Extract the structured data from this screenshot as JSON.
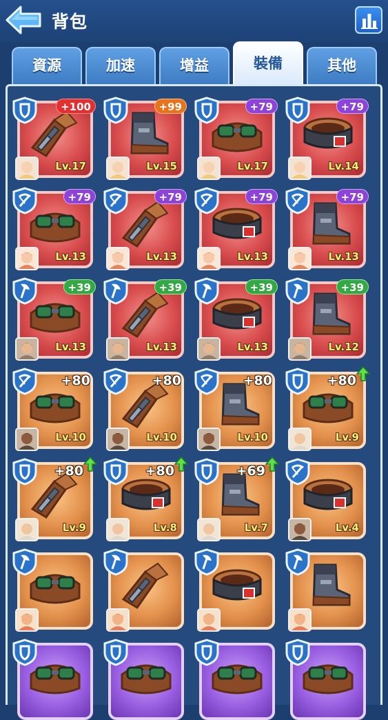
{
  "header": {
    "title": "背包"
  },
  "tabs": [
    {
      "label": "資源",
      "active": false
    },
    {
      "label": "加速",
      "active": false
    },
    {
      "label": "增益",
      "active": false
    },
    {
      "label": "裝備",
      "active": true
    },
    {
      "label": "其他",
      "active": false
    }
  ],
  "items": [
    {
      "rarity": "red",
      "class_icon": "shield",
      "badge": "+100",
      "badge_color": "red",
      "hero": "blonde-woman",
      "level": "Lv.17",
      "art": "gauntlet"
    },
    {
      "rarity": "red",
      "class_icon": "shield",
      "badge": "+99",
      "badge_color": "orange",
      "hero": "blonde-woman",
      "level": "Lv.15",
      "art": "boot"
    },
    {
      "rarity": "red",
      "class_icon": "shield",
      "badge": "+79",
      "badge_color": "purple",
      "hero": "blonde-woman",
      "level": "Lv.17",
      "art": "goggles"
    },
    {
      "rarity": "red",
      "class_icon": "shield",
      "badge": "+79",
      "badge_color": "purple",
      "hero": "blonde-woman",
      "level": "Lv.14",
      "art": "belt"
    },
    {
      "rarity": "red",
      "class_icon": "crossbow",
      "badge": "+79",
      "badge_color": "purple",
      "hero": "redhead-girl",
      "level": "Lv.13",
      "art": "goggles"
    },
    {
      "rarity": "red",
      "class_icon": "crossbow",
      "badge": "+79",
      "badge_color": "purple",
      "hero": "redhead-girl",
      "level": "Lv.13",
      "art": "gauntlet"
    },
    {
      "rarity": "red",
      "class_icon": "crossbow",
      "badge": "+79",
      "badge_color": "purple",
      "hero": "redhead-girl",
      "level": "Lv.13",
      "art": "belt"
    },
    {
      "rarity": "red",
      "class_icon": "crossbow",
      "badge": "+79",
      "badge_color": "purple",
      "hero": "redhead-girl",
      "level": "Lv.13",
      "art": "boot"
    },
    {
      "rarity": "red",
      "class_icon": "axe",
      "badge": "+39",
      "badge_color": "green",
      "hero": "bearded-dwarf",
      "level": "Lv.13",
      "art": "goggles"
    },
    {
      "rarity": "red",
      "class_icon": "axe",
      "badge": "+39",
      "badge_color": "green",
      "hero": "bearded-dwarf",
      "level": "Lv.13",
      "art": "gauntlet"
    },
    {
      "rarity": "red",
      "class_icon": "axe",
      "badge": "+39",
      "badge_color": "green",
      "hero": "bearded-dwarf",
      "level": "Lv.13",
      "art": "belt"
    },
    {
      "rarity": "red",
      "class_icon": "axe",
      "badge": "+39",
      "badge_color": "green",
      "hero": "bearded-dwarf",
      "level": "Lv.12",
      "art": "boot"
    },
    {
      "rarity": "orange",
      "class_icon": "crossbow",
      "badge": "+80",
      "badge_color": "plain",
      "arrow": false,
      "hero": "bald-man",
      "level": "Lv.10",
      "art": "goggles"
    },
    {
      "rarity": "orange",
      "class_icon": "crossbow",
      "badge": "+80",
      "badge_color": "plain",
      "arrow": false,
      "hero": "bald-man",
      "level": "Lv.10",
      "art": "gauntlet"
    },
    {
      "rarity": "orange",
      "class_icon": "crossbow",
      "badge": "+80",
      "badge_color": "plain",
      "arrow": false,
      "hero": "bald-man",
      "level": "Lv.10",
      "art": "boot"
    },
    {
      "rarity": "orange",
      "class_icon": "shield",
      "badge": "+80",
      "badge_color": "plain",
      "arrow": true,
      "hero": "old-dwarf",
      "level": "Lv.9",
      "art": "goggles"
    },
    {
      "rarity": "orange",
      "class_icon": "shield",
      "badge": "+80",
      "badge_color": "plain",
      "arrow": true,
      "hero": "old-dwarf",
      "level": "Lv.9",
      "art": "gauntlet"
    },
    {
      "rarity": "orange",
      "class_icon": "shield",
      "badge": "+80",
      "badge_color": "plain",
      "arrow": true,
      "hero": "old-dwarf",
      "level": "Lv.8",
      "art": "belt"
    },
    {
      "rarity": "orange",
      "class_icon": "shield",
      "badge": "+69",
      "badge_color": "plain",
      "arrow": true,
      "hero": "old-dwarf",
      "level": "Lv.7",
      "art": "boot"
    },
    {
      "rarity": "orange",
      "class_icon": "crossbow",
      "badge": "",
      "badge_color": "none",
      "hero": "bald-man",
      "level": "Lv.4",
      "art": "belt"
    },
    {
      "rarity": "orange",
      "class_icon": "axe",
      "badge": "",
      "badge_color": "none",
      "hero": "red-haired-brawler",
      "level": "",
      "art": "goggles"
    },
    {
      "rarity": "orange",
      "class_icon": "axe",
      "badge": "",
      "badge_color": "none",
      "hero": "red-haired-brawler",
      "level": "",
      "art": "gauntlet"
    },
    {
      "rarity": "orange",
      "class_icon": "axe",
      "badge": "",
      "badge_color": "none",
      "hero": "red-haired-brawler",
      "level": "",
      "art": "belt"
    },
    {
      "rarity": "orange",
      "class_icon": "axe",
      "badge": "",
      "badge_color": "none",
      "hero": "red-haired-brawler",
      "level": "",
      "art": "boot"
    },
    {
      "rarity": "purple",
      "class_icon": "shield",
      "badge": "",
      "badge_color": "none",
      "hero": "",
      "level": "",
      "art": "goggles"
    },
    {
      "rarity": "purple",
      "class_icon": "shield",
      "badge": "",
      "badge_color": "none",
      "hero": "",
      "level": "",
      "art": "goggles"
    },
    {
      "rarity": "purple",
      "class_icon": "shield",
      "badge": "",
      "badge_color": "none",
      "hero": "",
      "level": "",
      "art": "goggles"
    },
    {
      "rarity": "purple",
      "class_icon": "shield",
      "badge": "",
      "badge_color": "none",
      "hero": "",
      "level": "",
      "art": "goggles"
    }
  ]
}
